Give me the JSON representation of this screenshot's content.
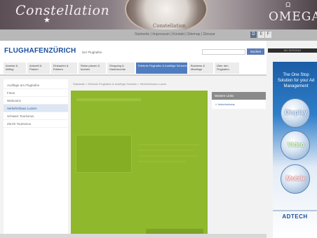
{
  "banner": {
    "brand": "Constellation",
    "star_glyph": "★",
    "watch_name": "Constellation",
    "omega_symbol": "Ω",
    "omega": "OMEGA",
    "colors": {
      "omega_text": "#f3eef0"
    }
  },
  "utility": {
    "links": "Startseite | Impressum | Kontakt | Sitemap | Glossar",
    "lang": [
      "D",
      "E",
      "F"
    ]
  },
  "header": {
    "logo": "FLUGHAFENZÜRICH",
    "logo_sub": "Der Flughafen",
    "search_placeholder": "",
    "search_button": "Suchen"
  },
  "nav": {
    "tabs": [
      {
        "label": "Anreise & Abflug"
      },
      {
        "label": "Ankunft & Parken"
      },
      {
        "label": "Einkaufen & Erleben"
      },
      {
        "label": "Reise planen & buchen"
      },
      {
        "label": "Shopping & Gastronomie"
      },
      {
        "label": "Erlebnis Flughafen & Ausflüge Schweiz"
      },
      {
        "label": "Business & Meetings"
      },
      {
        "label": "Über den Flughafen"
      }
    ],
    "active_index": 5
  },
  "ad": {
    "label": "AD SERVING",
    "pitch": "The One Stop Solution for your Ad Management",
    "balls": [
      "Display",
      "Video",
      "Mobile"
    ],
    "brand": "ADTECH"
  },
  "sidebar": {
    "items": [
      {
        "label": "Ausflüge am Flughafen"
      },
      {
        "label": "Fotos"
      },
      {
        "label": "Webcams"
      },
      {
        "label": "Verkehrshaus Luzern"
      },
      {
        "label": "Schweiz Tourismus"
      },
      {
        "label": "Zürich Tourismus"
      }
    ],
    "current_index": 3
  },
  "breadcrumb": "Startseite > Erlebnis Flughafen & Ausflüge Schweiz > Verkehrshaus Luzern",
  "related": {
    "title": "Weitere Links",
    "link": "» Verkehrshaus"
  }
}
